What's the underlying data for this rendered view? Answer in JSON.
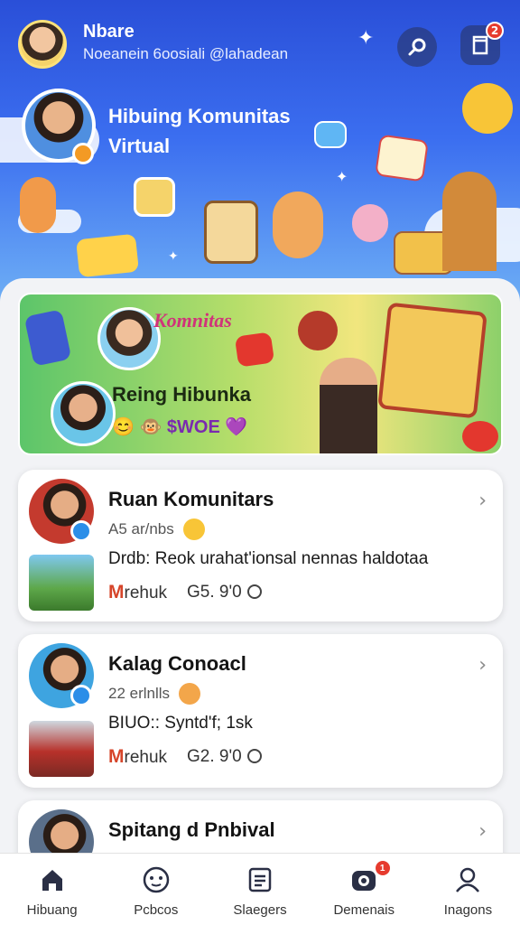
{
  "header": {
    "user_name": "Nbare",
    "user_handle": "Noeanein 6oosiali @lahadean",
    "search_icon": "search-icon",
    "notifications_icon": "bookmark-icon",
    "notification_count": "2"
  },
  "hero": {
    "title": "Hibuing Komunitas Virtual"
  },
  "banner": {
    "tag": "Komnitas",
    "title": "Reing Hibunka",
    "subtitle": "😊 🐵 $WOE 💜"
  },
  "cards": [
    {
      "title": "Ruan Komunitars",
      "meta": "A5 ar/nbs",
      "body": "Drdb: Reok urahat'ionsal nennas haldotaa",
      "brand": "M",
      "brand_rest": "rehuk",
      "stat": "G5. 9'0"
    },
    {
      "title": "Kalag Conoacl",
      "meta": "22 erlnlls",
      "body": "BIUO:: Syntd'f; 1sk",
      "brand": "M",
      "brand_rest": "rehuk",
      "stat": "G2. 9'0"
    },
    {
      "title": "Spitang d Pnbival"
    }
  ],
  "nav": {
    "items": [
      {
        "label": "Hibuang",
        "icon": "home-icon"
      },
      {
        "label": "Pcbcos",
        "icon": "smiley-icon"
      },
      {
        "label": "Slaegers",
        "icon": "list-icon"
      },
      {
        "label": "Demenais",
        "icon": "camera-icon",
        "badge": "1"
      },
      {
        "label": "Inagons",
        "icon": "profile-icon"
      }
    ]
  },
  "colors": {
    "hero_top": "#2a4fd8",
    "accent_badge": "#e63b2e",
    "brand_red": "#d6452a"
  }
}
